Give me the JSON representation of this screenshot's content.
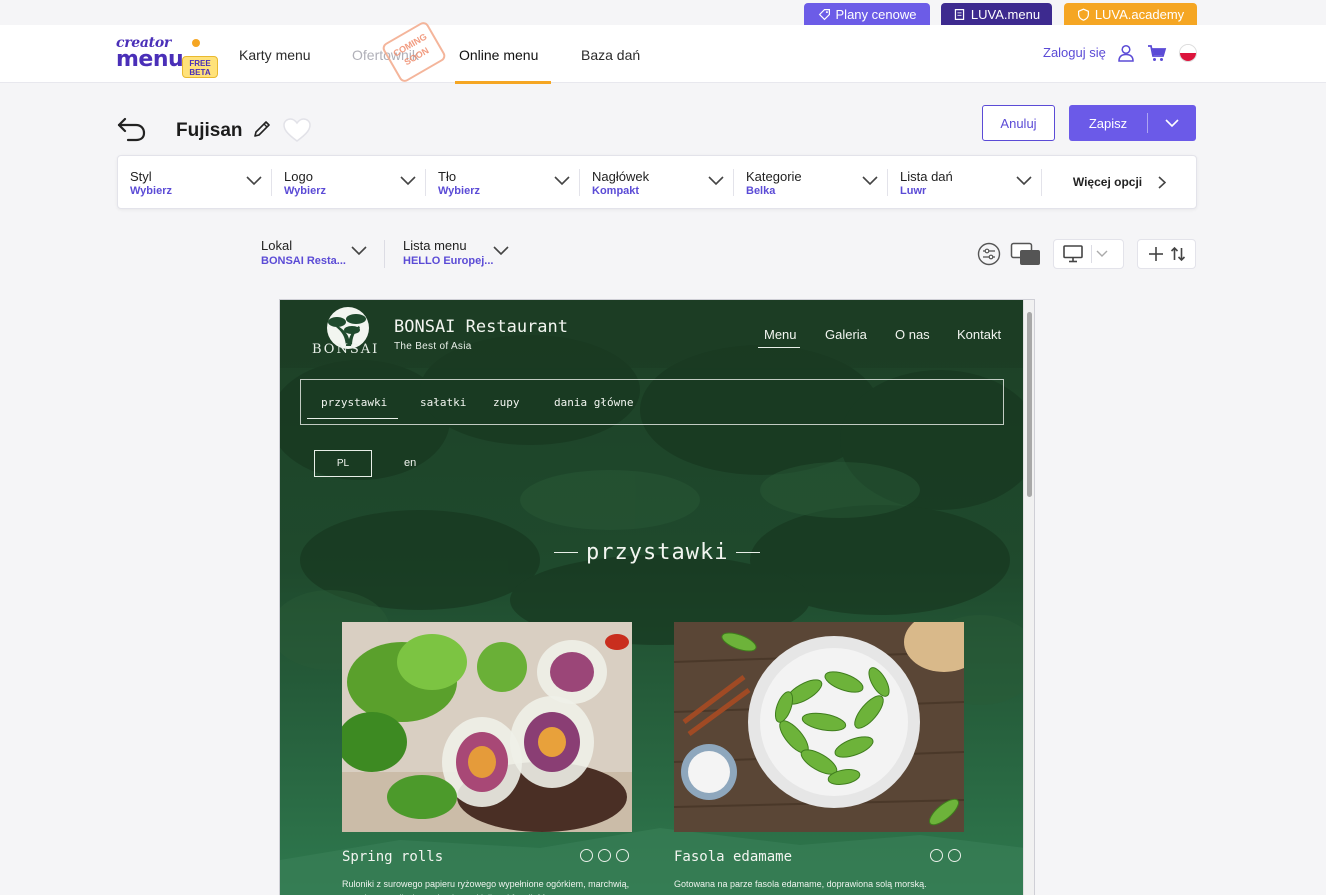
{
  "promos": {
    "plans": "Plany cenowe",
    "luva_menu": "LUVA.menu",
    "luva_academy": "LUVA.academy"
  },
  "header": {
    "logo": {
      "line1": "creator",
      "line2": "menu",
      "badge_line1": "FREE",
      "badge_line2": "BETA"
    },
    "nav": [
      {
        "label": "Karty menu"
      },
      {
        "label": "Ofertownik",
        "badge": "COMING SOON"
      },
      {
        "label": "Online menu"
      },
      {
        "label": "Baza dań"
      }
    ],
    "login": "Zaloguj się"
  },
  "editor": {
    "title": "Fujisan",
    "cancel_label": "Anuluj",
    "save_label": "Zapisz"
  },
  "options": [
    {
      "label": "Styl",
      "value": "Wybierz"
    },
    {
      "label": "Logo",
      "value": "Wybierz"
    },
    {
      "label": "Tło",
      "value": "Wybierz"
    },
    {
      "label": "Nagłówek",
      "value": "Kompakt"
    },
    {
      "label": "Kategorie",
      "value": "Belka"
    },
    {
      "label": "Lista dań",
      "value": "Luwr"
    }
  ],
  "more_options": "Więcej opcji",
  "selectors": {
    "lokal": {
      "label": "Lokal",
      "value": "BONSAI Resta..."
    },
    "lista": {
      "label": "Lista menu",
      "value": "HELLO Europej..."
    }
  },
  "preview": {
    "logo_text": "BONSAI",
    "restaurant_name": "BONSAI Restaurant",
    "tagline": "The Best of Asia",
    "nav": [
      "Menu",
      "Galeria",
      "O nas",
      "Kontakt"
    ],
    "categories": [
      "przystawki",
      "sałatki",
      "zupy",
      "dania główne"
    ],
    "languages": [
      "PL",
      "en"
    ],
    "section_title": "przystawki",
    "dishes": [
      {
        "name": "Spring rolls",
        "description": "Ruloniki z surowego papieru ryżowego wypełnione ogórkiem, marchwią, mangiem, rzodkwią, pędami oraz kiełkami fasoli. Mus..."
      },
      {
        "name": "Fasola edamame",
        "description": "Gotowana na parze fasola edamame, doprawiona solą morską."
      }
    ]
  },
  "colors": {
    "accent": "#6b5ae8",
    "brand_dark": "#4a2fb8",
    "orange": "#f5a623",
    "preview_bg": "#1e4a2f"
  }
}
